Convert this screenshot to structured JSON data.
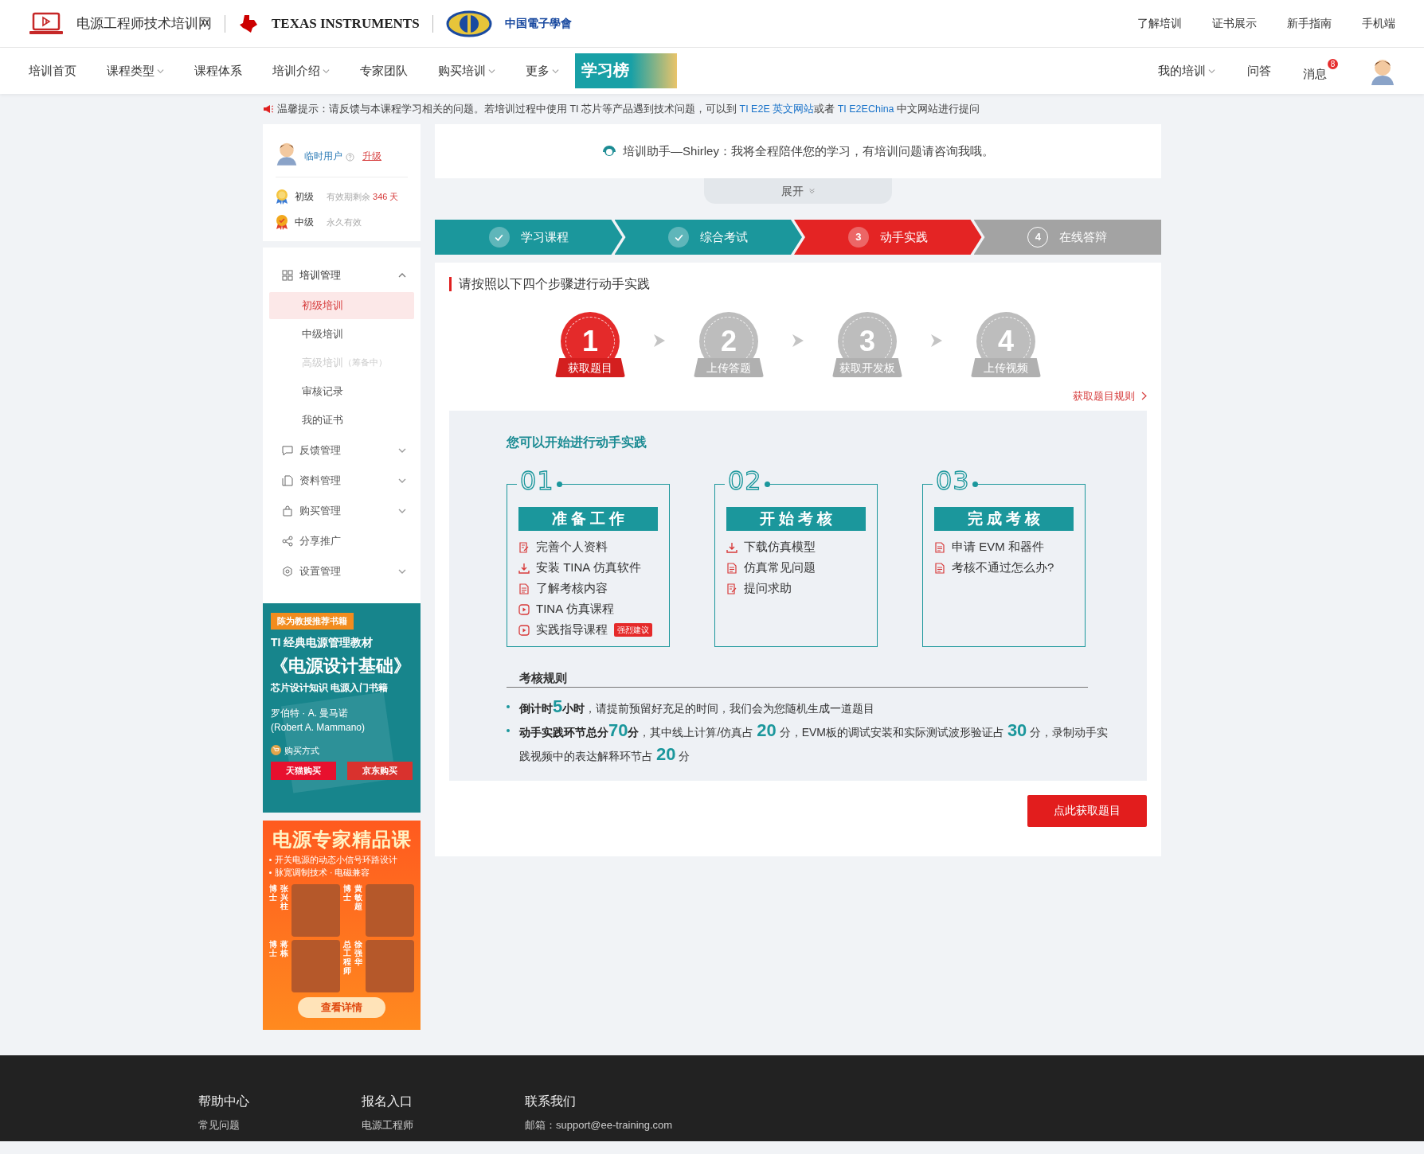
{
  "header": {
    "site_name": "电源工程师技术培训网",
    "partner_1": "TEXAS INSTRUMENTS",
    "partner_2": "中国電子學會",
    "top_links": [
      "了解培训",
      "证书展示",
      "新手指南",
      "手机端"
    ]
  },
  "nav": {
    "items": [
      {
        "label": "培训首页",
        "dropdown": false
      },
      {
        "label": "课程类型",
        "dropdown": true
      },
      {
        "label": "课程体系",
        "dropdown": false
      },
      {
        "label": "培训介绍",
        "dropdown": true
      },
      {
        "label": "专家团队",
        "dropdown": false
      },
      {
        "label": "购买培训",
        "dropdown": true
      },
      {
        "label": "更多",
        "dropdown": true
      }
    ],
    "banner": "学习榜",
    "right_items": [
      {
        "label": "我的培训",
        "dropdown": true
      },
      {
        "label": "问答",
        "dropdown": false
      }
    ],
    "messages": {
      "label": "消息",
      "count": "8"
    }
  },
  "notice": [
    {
      "kind": "text",
      "text": "温馨提示：请反馈与本课程学习相关的问题。若培训过程中使用 TI 芯片等产品遇到技术问题，可以到 "
    },
    {
      "kind": "link",
      "text": "TI E2E 英文网站"
    },
    {
      "kind": "text",
      "text": "或者 "
    },
    {
      "kind": "link",
      "text": "TI E2EChina"
    },
    {
      "kind": "text",
      "text": " 中文网站进行提问"
    }
  ],
  "user": {
    "role": "临时用户",
    "upgrade": "升级",
    "levels": [
      {
        "kind": "basic",
        "name": "初级",
        "note": "有效期剩余",
        "days": "346 天"
      },
      {
        "kind": "checked",
        "name": "中级",
        "note": "永久有效"
      }
    ]
  },
  "menu": [
    {
      "label": "培训管理",
      "expandable": true,
      "expanded": true,
      "children": [
        {
          "label": "初级培训",
          "selected": true,
          "disabled": false
        },
        {
          "label": "中级培训",
          "selected": false,
          "disabled": false
        },
        {
          "label": "高级培训",
          "note": "（筹备中）",
          "selected": false,
          "disabled": true
        },
        {
          "label": "审核记录",
          "selected": false,
          "disabled": false
        },
        {
          "label": "我的证书",
          "selected": false,
          "disabled": false
        }
      ]
    },
    {
      "label": "反馈管理",
      "expandable": true,
      "expanded": false
    },
    {
      "label": "资料管理",
      "expandable": true,
      "expanded": false
    },
    {
      "label": "购买管理",
      "expandable": true,
      "expanded": false
    },
    {
      "label": "分享推广",
      "expandable": false,
      "expanded": false
    },
    {
      "label": "设置管理",
      "expandable": true,
      "expanded": false
    }
  ],
  "ads": [
    {
      "kind": "book",
      "tag": "陈为教授推荐书籍",
      "lines": [
        "TI 经典电源管理教材",
        "《电源设计基础》",
        "芯片设计知识 电源入门书籍"
      ],
      "author": "罗伯特 · A. 曼马诺",
      "author_en": "(Robert A. Mammano)",
      "buy_label": "购买方式",
      "buttons": [
        "天猫购买",
        "京东购买"
      ]
    },
    {
      "kind": "course",
      "title": "电源专家精品课",
      "bullets": [
        "开关电源的动态小信号环路设计",
        "脉宽调制技术 · 电磁兼容"
      ],
      "people": [
        {
          "title": "博士",
          "name": "张兴柱"
        },
        {
          "title": "博士",
          "name": "黄敏超"
        },
        {
          "title": "博士",
          "name": "蒋栋"
        },
        {
          "title": "总工程师",
          "name": "徐强华"
        }
      ],
      "button": "查看详情"
    }
  ],
  "assistant": "培训助手—Shirley：我将全程陪伴您的学习，有培训问题请咨询我哦。",
  "expand": "展开",
  "progress": [
    {
      "label": "学习课程",
      "done": true,
      "selected": false
    },
    {
      "label": "综合考试",
      "done": true,
      "selected": false
    },
    {
      "number": "3",
      "label": "动手实践",
      "done": false,
      "selected": true
    },
    {
      "number": "4",
      "label": "在线答辩",
      "done": false,
      "selected": false
    }
  ],
  "section_title": "请按照以下四个步骤进行动手实践",
  "steps": [
    {
      "number": "1",
      "label": "获取题目",
      "selected": true
    },
    {
      "number": "2",
      "label": "上传答题",
      "selected": false
    },
    {
      "number": "3",
      "label": "获取开发板",
      "selected": false
    },
    {
      "number": "4",
      "label": "上传视频",
      "selected": false
    }
  ],
  "rules_link": "获取题目规则",
  "panel": {
    "title": "您可以开始进行动手实践",
    "stages": [
      {
        "number": "01",
        "title": "准 备 工 作",
        "items": [
          {
            "kind": "edit",
            "text": "完善个人资料"
          },
          {
            "kind": "download",
            "text": "安装 TINA 仿真软件"
          },
          {
            "kind": "doc",
            "text": "了解考核内容"
          },
          {
            "kind": "video",
            "text": "TINA 仿真课程"
          },
          {
            "kind": "video",
            "text": "实践指导课程",
            "tag": "强烈建议"
          }
        ]
      },
      {
        "number": "02",
        "title": "开 始 考 核",
        "items": [
          {
            "kind": "download",
            "text": "下载仿真模型"
          },
          {
            "kind": "doc",
            "text": "仿真常见问题"
          },
          {
            "kind": "edit",
            "text": "提问求助"
          }
        ]
      },
      {
        "number": "03",
        "title": "完 成 考 核",
        "items": [
          {
            "kind": "doc",
            "text": "申请 EVM 和器件"
          },
          {
            "kind": "doc",
            "text": "考核不通过怎么办?"
          }
        ]
      }
    ],
    "rules_title": "考核规则",
    "rules": [
      [
        {
          "kind": "bold",
          "text": "倒计时"
        },
        {
          "kind": "number",
          "text": "5"
        },
        {
          "kind": "bold",
          "text": "小时"
        },
        {
          "kind": "plain",
          "text": "，请提前预留好充足的时间，我们会为您随机生成一道题目"
        }
      ],
      [
        {
          "kind": "bold",
          "text": "动手实践环节总分"
        },
        {
          "kind": "number",
          "text": "70"
        },
        {
          "kind": "bold",
          "text": "分"
        },
        {
          "kind": "plain",
          "text": "，其中线上计算/仿真占 "
        },
        {
          "kind": "number",
          "text": "20"
        },
        {
          "kind": "plain",
          "text": " 分，EVM板的调试安装和实际测试波形验证占 "
        },
        {
          "kind": "number",
          "text": "30"
        },
        {
          "kind": "plain",
          "text": " 分，录制动手实践视频中的表达解释环节占 "
        },
        {
          "kind": "number",
          "text": "20"
        },
        {
          "kind": "plain",
          "text": " 分"
        }
      ]
    ]
  },
  "action_button": "点此获取题目",
  "footer": [
    {
      "title": "帮助中心",
      "items": [
        "常见问题"
      ]
    },
    {
      "title": "报名入口",
      "items": [
        "电源工程师"
      ]
    },
    {
      "title": "联系我们",
      "items": [
        "邮箱：support@ee-training.com"
      ]
    }
  ]
}
